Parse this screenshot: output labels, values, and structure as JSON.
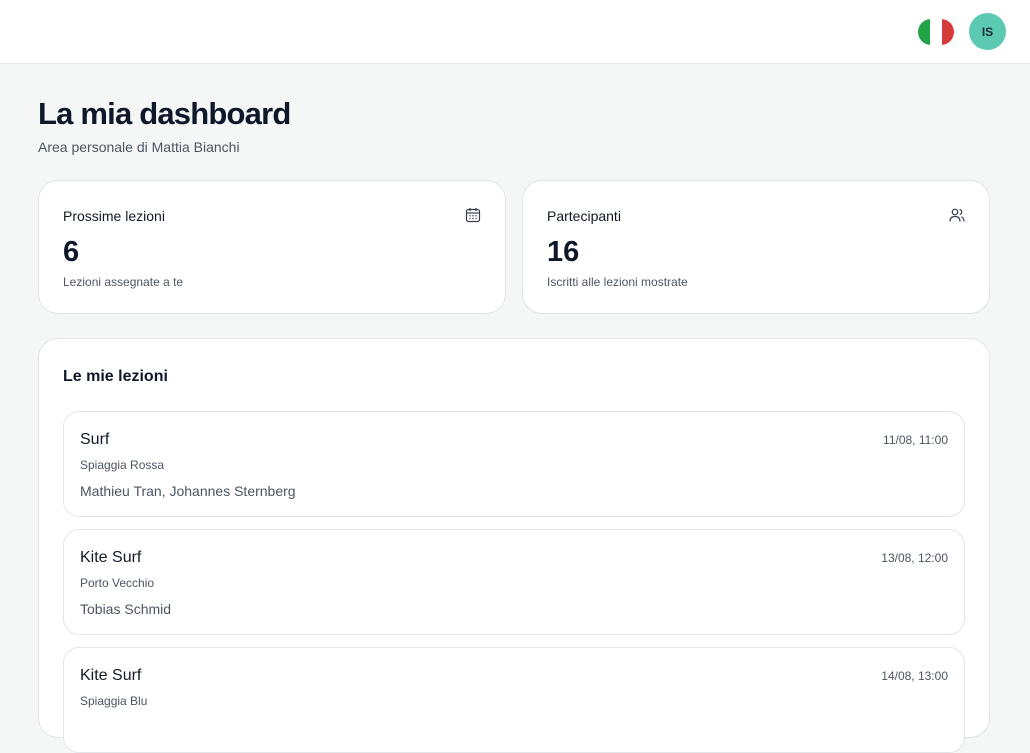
{
  "header": {
    "language": "Italiano",
    "flag_colors": [
      "#22a34a",
      "#ffffff",
      "#d63b3b"
    ],
    "avatar_initials": "IS",
    "avatar_color": "#5cc9b2"
  },
  "page": {
    "title": "La mia dashboard",
    "subtitle": "Area personale di Mattia Bianchi"
  },
  "stats": [
    {
      "label": "Prossime lezioni",
      "value": "6",
      "description": "Lezioni assegnate a te",
      "icon": "calendar-icon"
    },
    {
      "label": "Partecipanti",
      "value": "16",
      "description": "Iscritti alle lezioni mostrate",
      "icon": "users-icon"
    }
  ],
  "lessons": {
    "title": "Le mie lezioni",
    "items": [
      {
        "title": "Surf",
        "date": "11/08, 11:00",
        "location": "Spiaggia Rossa",
        "participants": "Mathieu Tran, Johannes Sternberg"
      },
      {
        "title": "Kite Surf",
        "date": "13/08, 12:00",
        "location": "Porto Vecchio",
        "participants": "Tobias Schmid"
      },
      {
        "title": "Kite Surf",
        "date": "14/08, 13:00",
        "location": "Spiaggia Blu",
        "participants": ""
      }
    ]
  }
}
